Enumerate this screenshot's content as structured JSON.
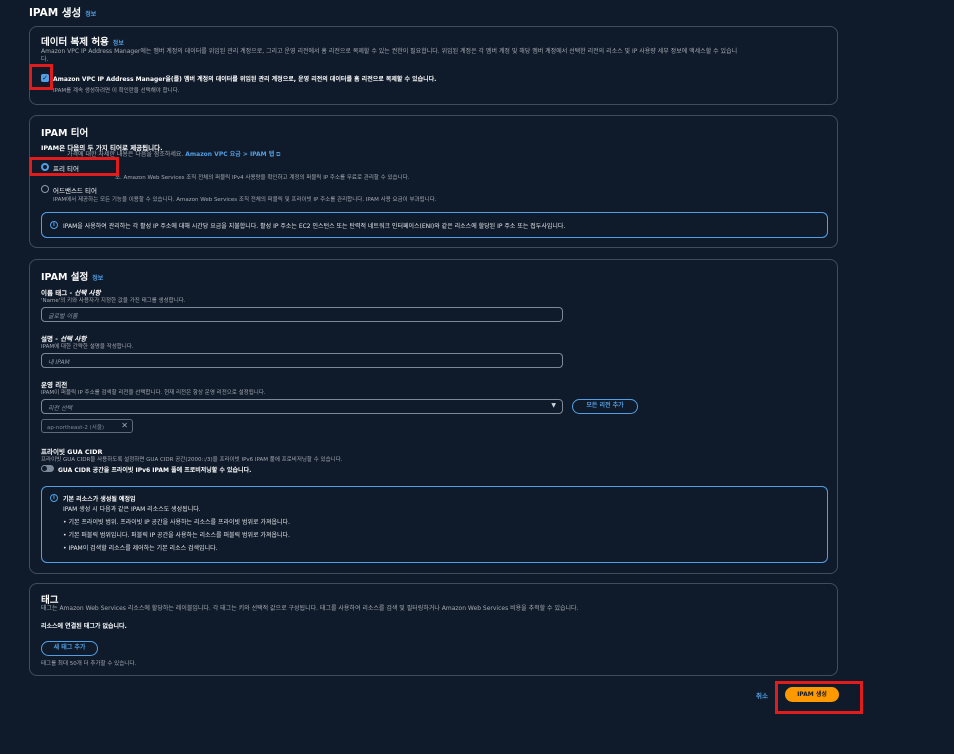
{
  "page": {
    "title": "IPAM 생성",
    "info": "정보"
  },
  "replication": {
    "title": "데이터 복제 허용",
    "info": "정보",
    "desc1": "Amazon VPC IP Address Manager에는 멤버 계정의 데이터를 위임된 관리 계정으로, 그리고 운영 리전에서 홈 리전으로 복제할 수 있는 권한이 필요합니다. 위임된 계정은 각 멤버 계정 및 해당 멤버 계정에서 선택한 리전의 리소스 및 IP 사용량 세부 정보에 액세스할 수 있습니",
    "desc2": "다.",
    "checkbox_label": "Amazon VPC IP Address Manager을(를) 멤버 계정의 데이터를 위임된 관리 계정으로, 운영 리전의 데이터를 홈 리전으로 복제할 수 있습니다.",
    "checkbox_hint": "IPAM를 계속 생성하려면 이 확인란을 선택해야 합니다.",
    "checked": true
  },
  "tier": {
    "title": "IPAM 티어",
    "subtitle": "IPAM은 다음의 두 가지 티어로 제공됩니다.",
    "desc": "가격에 대한 자세한 내용은 다음을 참조하세요.",
    "pricing_link": "Amazon VPC 요금 > IPAM 탭",
    "options": [
      {
        "label": "프리 티어",
        "desc": "조. Amazon Web Services 조직 전체의 퍼블릭 IPv4 사용량을 확인하고 계정의 퍼블릭 IP 주소를 무료로 관리할 수 있습니다.",
        "selected": true
      },
      {
        "label": "어드밴스드 티어",
        "desc": "IPAM에서 제공하는 모든 기능을 이용할 수 있습니다. Amazon Web Services 조직 전체의 퍼블릭 및 프라이빗 IP 주소를 관리합니다. IPAM 사용 요금이 부과됩니다.",
        "selected": false
      }
    ],
    "notice": "IPAM을 사용하여 관리하는 각 활성 IP 주소에 대해 시간당 요금을 지불합니다. 활성 IP 주소는 EC2 인스턴스 또는 탄력적 네트워크 인터페이스(ENI)와 같은 리소스에 할당된 IP 주소 또는 접두사입니다."
  },
  "settings": {
    "title": "IPAM 설정",
    "info": "정보",
    "name_tag": {
      "label": "이름 태그 - ",
      "optional": "선택 사항",
      "hint": "'Name'의 키와 사용자가 지정한 값을 가진 태그를 생성합니다.",
      "placeholder": "글로벌 이름"
    },
    "description": {
      "label": "설명 - ",
      "optional": "선택 사항",
      "hint": "IPAM에 대한 간략한 설명을 작성합니다.",
      "placeholder": "내 IPAM"
    },
    "operating_regions": {
      "label": "운영 리전",
      "hint": "IPAM이 퍼블릭 IP 주소를 검색할 리전을 선택합니다. 현재 리전은 항상 운영 리전으로 설정됩니다.",
      "select_placeholder": "리전 선택",
      "add_all_button": "모든 리전 추가",
      "token": "ap-northeast-2 (서울)"
    },
    "private_gua": {
      "label": "프라이빗 GUA CIDR",
      "hint": "프라이빗 GUA CIDR을 사용하도록 설정하면 GUA CIDR 공간(2000::/3)을 프라이빗 IPv6 IPAM 풀에 프로비저닝할 수 있습니다.",
      "toggle_label": "GUA CIDR 공간을 프라이빗 IPv6 IPAM 풀에 프로비저닝할 수 있습니다.",
      "enabled": false
    },
    "default_resources": {
      "title": "기본 리소스가 생성될 예정임",
      "subtitle": "IPAM 생성 시 다음과 같은 IPAM 리소스도 생성됩니다.",
      "items": [
        "기본 프라이빗 범위. 프라이빗 IP 공간을 사용하는 리소스를 프라이빗 범위로 가져옵니다.",
        "기본 퍼블릭 범위입니다. 퍼블릭 IP 공간을 사용하는 리소스를 퍼블릭 범위로 가져옵니다.",
        "IPAM이 검색할 리소스를 제어하는 기본 리소스 검색입니다."
      ]
    }
  },
  "tags": {
    "title": "태그",
    "desc": "태그는 Amazon Web Services 리소스에 할당하는 레이블입니다. 각 태그는 키와 선택적 값으로 구성됩니다. 태그를 사용하여 리소스를 검색 및 필터링하거나 Amazon Web Services 비용을 추적할 수 있습니다.",
    "empty": "리소스에 연결된 태그가 없습니다.",
    "add_button": "새 태그 추가",
    "hint": "태그를 최대 50개 더 추가할 수 있습니다."
  },
  "footer": {
    "cancel": "취소",
    "create": "IPAM 생성"
  },
  "colors": {
    "accent": "#539fe5",
    "primary_button": "#ff9900",
    "highlight": "#e01c1c",
    "background": "#0f1b2a"
  }
}
